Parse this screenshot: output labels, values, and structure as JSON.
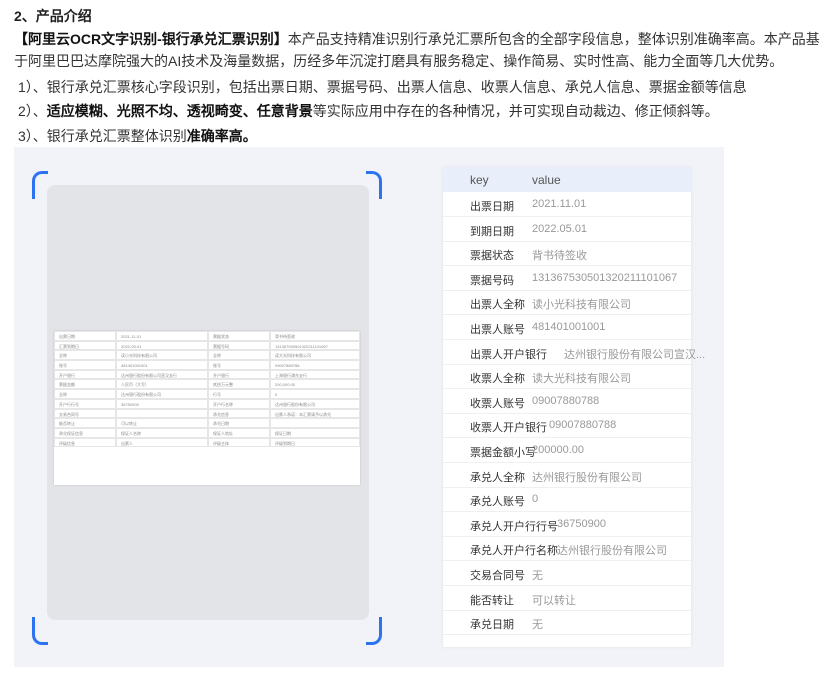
{
  "section_title": "2、产品介绍",
  "intro": {
    "highlight": "【阿里云OCR文字识别-银行承兑汇票识别】",
    "text": "本产品支持精准识别行承兑汇票所包含的全部字段信息，整体识别准确率高。本产品基于阿里巴巴达摩院强大的AI技术及海量数据，历经多年沉淀打磨具有服务稳定、操作简易、实时性高、能力全面等几大优势。"
  },
  "features": [
    {
      "prefix": "1）、银行承兑汇票核心字段识别，包括出票日期、票据号码、出票人信息、收票人信息、承兑人信息、票据金额等信息",
      "bold": "",
      "suffix": ""
    },
    {
      "prefix": "2）、",
      "bold": "适应模糊、光照不均、透视畸变、任意背景",
      "suffix": "等实际应用中存在的各种情况，并可实现自动裁边、修正倾斜等。"
    },
    {
      "prefix": "3）、银行承兑汇票整体识别",
      "bold": "准确率高。",
      "suffix": ""
    }
  ],
  "bill_preview": {
    "cells": [
      "出票日期",
      "2021-11-01",
      "票据状态",
      "背书待签收",
      "汇票到期日",
      "2022-05-01",
      "票据号码",
      "131367530501320211101067",
      "全称",
      "读小光科技有限公司",
      "全称",
      "读大光科技有限公司",
      "账号",
      "481401001001",
      "账号",
      "09007880788",
      "开户银行",
      "达州银行股份有限公司宣汉支行",
      "开户银行",
      "上海银行浦东支行",
      "票据金额",
      "人民币（大写）",
      "贰拾万元整",
      "200,000.00",
      "全称",
      "达州银行股份有限公司",
      "行号",
      "0",
      "开户行行号",
      "36750900",
      "开户行名称",
      "达州银行股份有限公司",
      "交易合同号",
      "",
      "承兑信息",
      "出票人承诺：本汇票请予以承兑",
      "能否转让",
      "可以转让",
      "承兑日期",
      "",
      "承兑保证信息",
      "保证人名称",
      "保证人地址",
      "保证日期",
      "评级信息",
      "出票人",
      "评级主体",
      "评级到期日"
    ]
  },
  "kv_table": {
    "header_key": "key",
    "header_value": "value",
    "rows": [
      {
        "key": "出票日期",
        "value": "2021.11.01"
      },
      {
        "key": "到期日期",
        "value": "2022.05.01"
      },
      {
        "key": "票据状态",
        "value": "背书待签收"
      },
      {
        "key": "票据号码",
        "value": "131367530501320211101067"
      },
      {
        "key": "出票人全称",
        "value": "读小光科技有限公司"
      },
      {
        "key": "出票人账号",
        "value": "481401001001"
      },
      {
        "key": "出票人开户银行",
        "value": "达州银行股份有限公司宣汉..."
      },
      {
        "key": "收票人全称",
        "value": "读大光科技有限公司"
      },
      {
        "key": "收票人账号",
        "value": "09007880788"
      },
      {
        "key": "收票人开户银行",
        "value": "09007880788"
      },
      {
        "key": "票据金额小写",
        "value": "200000.00"
      },
      {
        "key": "承兑人全称",
        "value": "达州银行股份有限公司"
      },
      {
        "key": "承兑人账号",
        "value": "0"
      },
      {
        "key": "承兑人开户行行号",
        "value": "36750900"
      },
      {
        "key": "承兑人开户行名称",
        "value": "达州银行股份有限公司"
      },
      {
        "key": "交易合同号",
        "value": "无"
      },
      {
        "key": "能否转让",
        "value": "可以转让"
      },
      {
        "key": "承兑日期",
        "value": "无"
      }
    ]
  }
}
